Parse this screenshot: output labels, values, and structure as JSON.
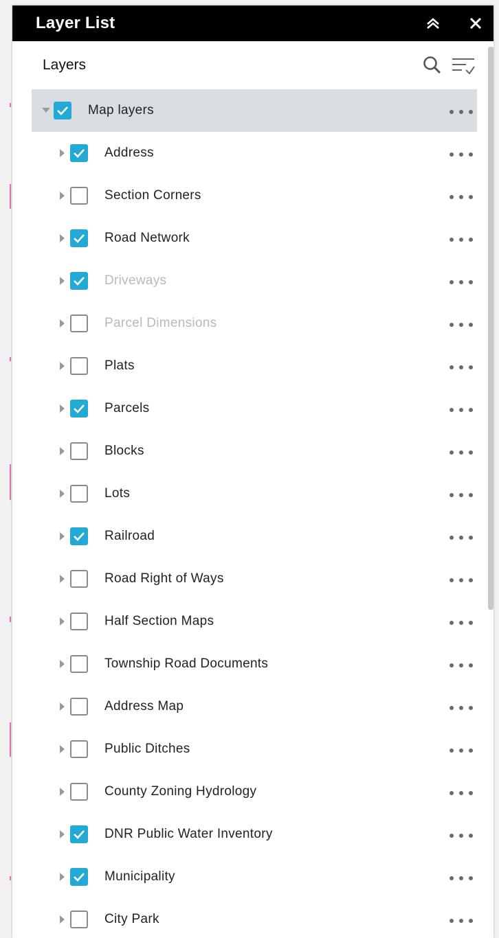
{
  "panel": {
    "title": "Layer List",
    "subheader_label": "Layers"
  },
  "root_layer": {
    "label": "Map layers",
    "checked": true
  },
  "layers": [
    {
      "label": "Address",
      "checked": true,
      "dimmed": false
    },
    {
      "label": "Section Corners",
      "checked": false,
      "dimmed": false
    },
    {
      "label": "Road Network",
      "checked": true,
      "dimmed": false
    },
    {
      "label": "Driveways",
      "checked": true,
      "dimmed": true
    },
    {
      "label": "Parcel Dimensions",
      "checked": false,
      "dimmed": true
    },
    {
      "label": "Plats",
      "checked": false,
      "dimmed": false
    },
    {
      "label": "Parcels",
      "checked": true,
      "dimmed": false
    },
    {
      "label": "Blocks",
      "checked": false,
      "dimmed": false
    },
    {
      "label": "Lots",
      "checked": false,
      "dimmed": false
    },
    {
      "label": "Railroad",
      "checked": true,
      "dimmed": false
    },
    {
      "label": "Road Right of Ways",
      "checked": false,
      "dimmed": false
    },
    {
      "label": "Half Section Maps",
      "checked": false,
      "dimmed": false
    },
    {
      "label": "Township Road Documents",
      "checked": false,
      "dimmed": false
    },
    {
      "label": "Address Map",
      "checked": false,
      "dimmed": false
    },
    {
      "label": "Public Ditches",
      "checked": false,
      "dimmed": false
    },
    {
      "label": "County Zoning Hydrology",
      "checked": false,
      "dimmed": false
    },
    {
      "label": "DNR Public Water Inventory",
      "checked": true,
      "dimmed": false
    },
    {
      "label": "Municipality",
      "checked": true,
      "dimmed": false
    },
    {
      "label": "City Park",
      "checked": false,
      "dimmed": false
    }
  ],
  "icons": {
    "collapse": "double-chevron-up-icon",
    "close": "close-icon",
    "search": "search-icon",
    "filter": "filter-list-icon",
    "expand": "caret-right-icon",
    "expanded": "caret-down-icon",
    "more": "more-options-icon"
  },
  "colors": {
    "header_bg": "#000000",
    "checkbox_on": "#22a9d4",
    "root_row_bg": "#d9dde1",
    "dimmed_text": "#b9b9b9"
  }
}
